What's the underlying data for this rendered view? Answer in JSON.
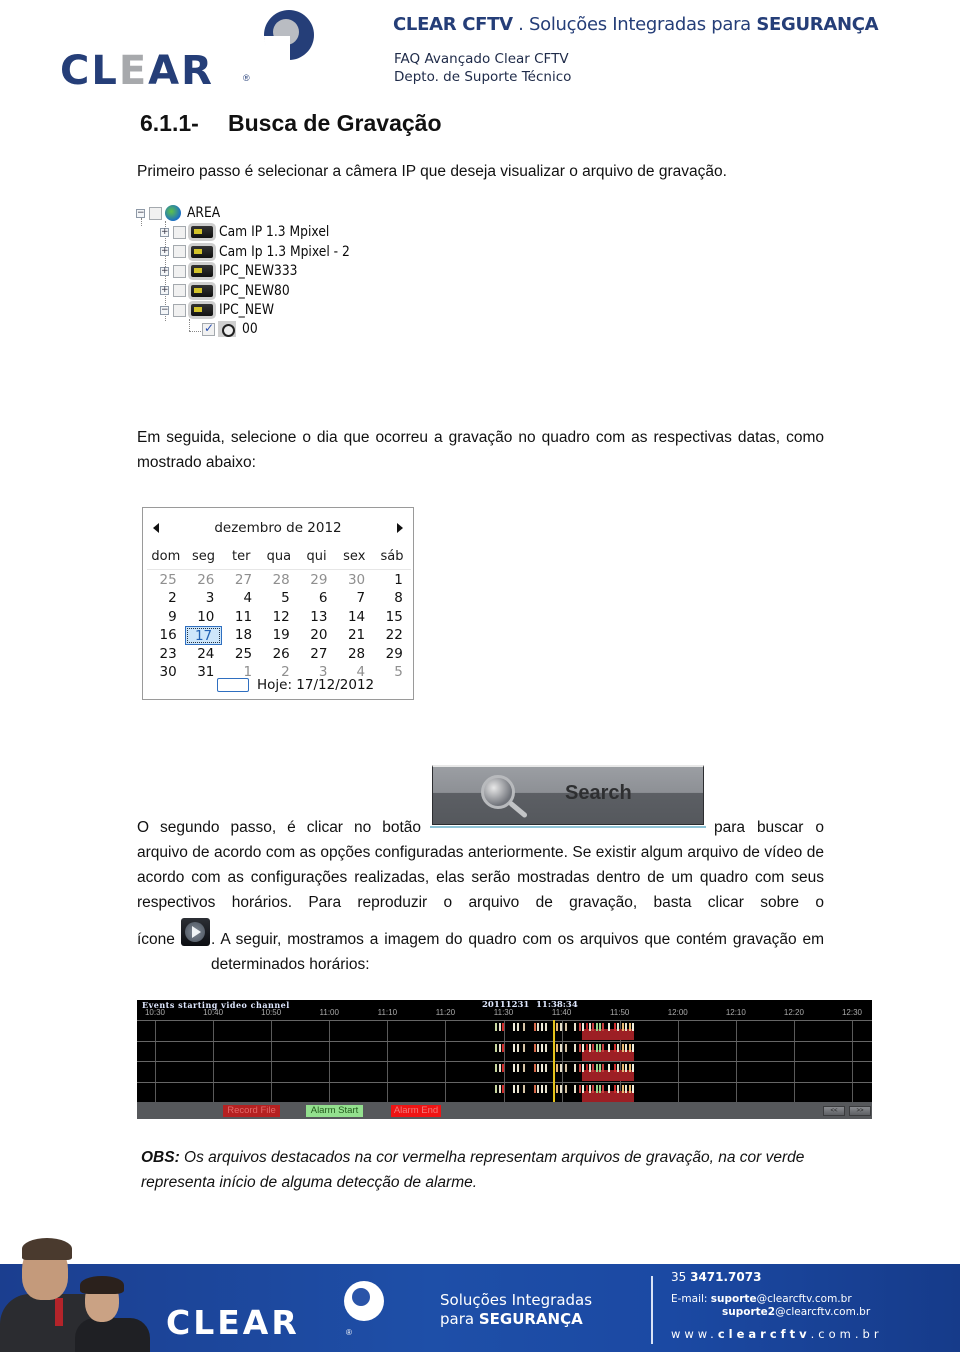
{
  "header": {
    "logo_text_dark": "CL",
    "logo_text_gray": "E",
    "logo_text_end": "AR",
    "logo_reg": "®",
    "tagline_brand": "CLEAR CFTV",
    "tagline_sep": " . Soluções Integradas para ",
    "tagline_strong": "SEGURANÇA",
    "subtitle_line1": "FAQ Avançado Clear CFTV",
    "subtitle_line2": "Depto. de Suporte Técnico"
  },
  "section": {
    "number": "6.1.1-",
    "title": "Busca de Gravação"
  },
  "paragraphs": {
    "step1": "Primeiro passo é selecionar a câmera IP que deseja visualizar o arquivo de gravação.",
    "step2": " Em seguida, selecione o dia que ocorreu a gravação no quadro com as respectivas datas, como mostrado abaixo:",
    "step3_before": "O segundo passo, é clicar no botão",
    "step3_after": "para buscar o",
    "step3_rest": "arquivo de acordo com as opções configuradas anteriormente. Se existir algum arquivo de vídeo de acordo com as configurações realizadas, elas serão mostradas dentro de um quadro com seus respectivos horários. Para reproduzir o arquivo de gravação, basta clicar sobre o",
    "step3_icone": "ícone",
    "step3_end": ". A seguir,  mostramos a imagem do quadro com os arquivos que contém gravação em determinados horários:"
  },
  "tree": {
    "root": {
      "label": "AREA",
      "checked": false,
      "expanded": true
    },
    "items": [
      {
        "label": "Cam IP 1.3 Mpixel",
        "checked": false,
        "expanded": false
      },
      {
        "label": "Cam Ip 1.3 Mpixel - 2",
        "checked": false,
        "expanded": false
      },
      {
        "label": "IPC_NEW333",
        "checked": false,
        "expanded": false
      },
      {
        "label": "IPC_NEW80",
        "checked": false,
        "expanded": false
      },
      {
        "label": "IPC_NEW",
        "checked": false,
        "expanded": true
      }
    ],
    "child": {
      "label": "00",
      "checked": true
    }
  },
  "calendar": {
    "title": "dezembro de 2012",
    "weekdays": [
      "dom",
      "seg",
      "ter",
      "qua",
      "qui",
      "sex",
      "sáb"
    ],
    "weeks": [
      [
        {
          "d": "25",
          "out": true
        },
        {
          "d": "26",
          "out": true
        },
        {
          "d": "27",
          "out": true
        },
        {
          "d": "28",
          "out": true
        },
        {
          "d": "29",
          "out": true
        },
        {
          "d": "30",
          "out": true
        },
        {
          "d": "1"
        }
      ],
      [
        {
          "d": "2"
        },
        {
          "d": "3"
        },
        {
          "d": "4"
        },
        {
          "d": "5"
        },
        {
          "d": "6"
        },
        {
          "d": "7"
        },
        {
          "d": "8"
        }
      ],
      [
        {
          "d": "9"
        },
        {
          "d": "10"
        },
        {
          "d": "11"
        },
        {
          "d": "12"
        },
        {
          "d": "13"
        },
        {
          "d": "14"
        },
        {
          "d": "15"
        }
      ],
      [
        {
          "d": "16"
        },
        {
          "d": "17",
          "sel": true
        },
        {
          "d": "18"
        },
        {
          "d": "19"
        },
        {
          "d": "20"
        },
        {
          "d": "21"
        },
        {
          "d": "22"
        }
      ],
      [
        {
          "d": "23"
        },
        {
          "d": "24"
        },
        {
          "d": "25"
        },
        {
          "d": "26"
        },
        {
          "d": "27"
        },
        {
          "d": "28"
        },
        {
          "d": "29"
        }
      ],
      [
        {
          "d": "30"
        },
        {
          "d": "31"
        },
        {
          "d": "1",
          "out": true
        },
        {
          "d": "2",
          "out": true
        },
        {
          "d": "3",
          "out": true
        },
        {
          "d": "4",
          "out": true
        },
        {
          "d": "5",
          "out": true
        }
      ]
    ],
    "selected_date": "17",
    "today_label": "Hoje: 17/12/2012"
  },
  "search_button": {
    "label": "Search"
  },
  "timeline": {
    "title": "Events starting video channel",
    "date": "20111231",
    "time": "11:38:34",
    "ticks": [
      "10:30",
      "10:40",
      "10:50",
      "11:00",
      "11:10",
      "11:20",
      "11:30",
      "11:40",
      "11:50",
      "12:00",
      "12:10",
      "12:20",
      "12:30"
    ],
    "tick_start_minutes": 630,
    "tick_step_minutes": 10,
    "cursor_minutes": 698.57,
    "channels": 4,
    "legend": [
      {
        "label": "Record File",
        "color": "#b52121"
      },
      {
        "label": "Alarm Start",
        "color": "#93e08e"
      },
      {
        "label": "Alarm End",
        "color": "#ee1414"
      }
    ],
    "nav_buttons": [
      "<<",
      ">>"
    ],
    "events_minutes": [
      {
        "t": 688.6,
        "c": "#c8d6a0"
      },
      {
        "t": 689.2,
        "c": "#e8e2cc"
      },
      {
        "t": 689.8,
        "c": "#d12c2c"
      },
      {
        "t": 691.6,
        "c": "#f2eedc"
      },
      {
        "t": 692.4,
        "c": "#e8e2cc"
      },
      {
        "t": 693.3,
        "c": "#d8c6a8"
      },
      {
        "t": 695.2,
        "c": "#d86a4a"
      },
      {
        "t": 695.7,
        "c": "#e8e2cc"
      },
      {
        "t": 696.5,
        "c": "#f2eedc"
      },
      {
        "t": 697.2,
        "c": "#e8e2cc"
      },
      {
        "t": 699.0,
        "c": "#e8b870"
      },
      {
        "t": 699.8,
        "c": "#e8e2cc"
      },
      {
        "t": 700.6,
        "c": "#d8c6a8"
      },
      {
        "t": 702.2,
        "c": "#e8e2cc"
      },
      {
        "t": 703.0,
        "c": "#c94040"
      },
      {
        "t": 703.6,
        "c": "#f2eedc"
      },
      {
        "t": 704.2,
        "c": "#b52121"
      },
      {
        "t": 704.7,
        "c": "#e8e2cc"
      },
      {
        "t": 705.3,
        "c": "#c94040"
      },
      {
        "t": 705.9,
        "c": "#9cd48c"
      },
      {
        "t": 706.4,
        "c": "#9cd48c"
      },
      {
        "t": 707.0,
        "c": "#c94040"
      },
      {
        "t": 708.0,
        "c": "#f2eedc"
      },
      {
        "t": 709.0,
        "c": "#d12c2c"
      },
      {
        "t": 709.6,
        "c": "#e8e2cc"
      },
      {
        "t": 710.4,
        "c": "#e8b870"
      },
      {
        "t": 711.0,
        "c": "#e8e2cc"
      },
      {
        "t": 711.6,
        "c": "#e8b870"
      },
      {
        "t": 712.2,
        "c": "#f2eedc"
      }
    ],
    "record_blocks_minutes": [
      [
        703.5,
        712.5
      ]
    ]
  },
  "obs": {
    "label": "OBS:",
    "text": " Os arquivos destacados na cor vermelha representam arquivos de gravação, na cor verde representa início de alguma detecção de alarme."
  },
  "footer": {
    "logo": "CLEAR",
    "reg": "®",
    "slogan_line1": "Soluções Integradas",
    "slogan_para": "para ",
    "slogan_strong": "SEGURANÇA",
    "phone_prefix": "35 ",
    "phone": "3471.7073",
    "email_label": "E-mail: ",
    "email1_user": "suporte",
    "email1_domain": "@clearcftv.com.br",
    "email2_user": "suporte2",
    "email2_domain": "@clearcftv.com.br",
    "web_prefix": "www.",
    "web_name": "clearcftv",
    "web_suffix": ".com.br"
  }
}
